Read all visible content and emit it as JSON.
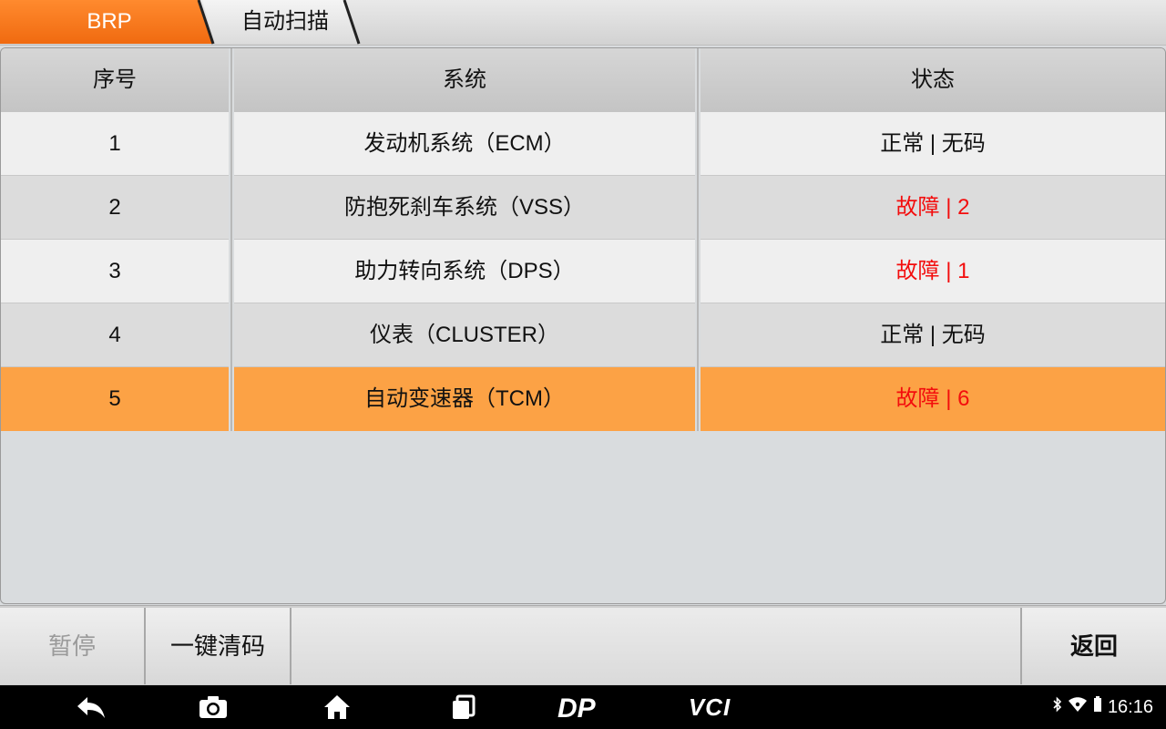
{
  "breadcrumb": {
    "root": "BRP",
    "current": "自动扫描"
  },
  "table": {
    "headers": [
      "序号",
      "系统",
      "状态"
    ],
    "rows": [
      {
        "index": "1",
        "system": "发动机系统（ECM）",
        "status": "正常 | 无码",
        "fault": false
      },
      {
        "index": "2",
        "system": "防抱死刹车系统（VSS）",
        "status": "故障 | 2",
        "fault": true
      },
      {
        "index": "3",
        "system": "助力转向系统（DPS）",
        "status": "故障 | 1",
        "fault": true
      },
      {
        "index": "4",
        "system": "仪表（CLUSTER）",
        "status": "正常 | 无码",
        "fault": false
      },
      {
        "index": "5",
        "system": "自动变速器（TCM）",
        "status": "故障 | 6",
        "fault": true,
        "selected": true
      }
    ]
  },
  "actions": {
    "pause": "暂停",
    "clear_codes": "一键清码",
    "back": "返回"
  },
  "navbar": {
    "dp_label": "DP",
    "vci_label": "VCI",
    "time": "16:16"
  },
  "colors": {
    "accent": "#f47a1c",
    "selected_row": "#fca245",
    "fault_text": "#f30d0d"
  }
}
